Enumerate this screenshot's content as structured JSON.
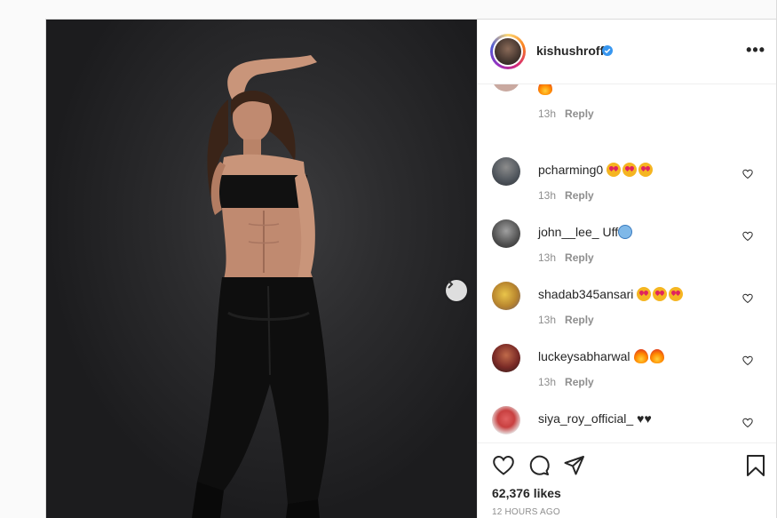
{
  "post": {
    "username": "kishushroff",
    "verified": true,
    "more_label": "•••"
  },
  "partial_comment": {
    "emoji": "fire",
    "time": "13h",
    "reply": "Reply"
  },
  "comments": [
    {
      "user": "pcharming0",
      "emojis": [
        "heart-eyes",
        "heart-eyes",
        "heart-eyes"
      ],
      "text": "",
      "time": "13h",
      "reply": "Reply",
      "avatar_color": "#5a5f66"
    },
    {
      "user": "john__lee_",
      "emojis": [
        "cold"
      ],
      "text": "Uff",
      "time": "13h",
      "reply": "Reply",
      "avatar_color": "#6d6d6d"
    },
    {
      "user": "shadab345ansari",
      "emojis": [
        "heart-eyes",
        "heart-eyes",
        "heart-eyes"
      ],
      "text": "",
      "time": "13h",
      "reply": "Reply",
      "avatar_color": "#c7a43a"
    },
    {
      "user": "luckeysabharwal",
      "emojis": [
        "fire",
        "fire"
      ],
      "text": "",
      "time": "13h",
      "reply": "Reply",
      "avatar_color": "#8a3a32"
    },
    {
      "user": "siya_roy_official_",
      "emojis": [],
      "text": "♥♥",
      "time": "",
      "reply": "",
      "avatar_color": "#d96a6a"
    }
  ],
  "actions": {
    "likes": "62,376 likes",
    "time": "12 HOURS AGO"
  },
  "colors": {
    "verified": "#3897f0",
    "muted": "#8e8e8e",
    "text": "#262626"
  }
}
